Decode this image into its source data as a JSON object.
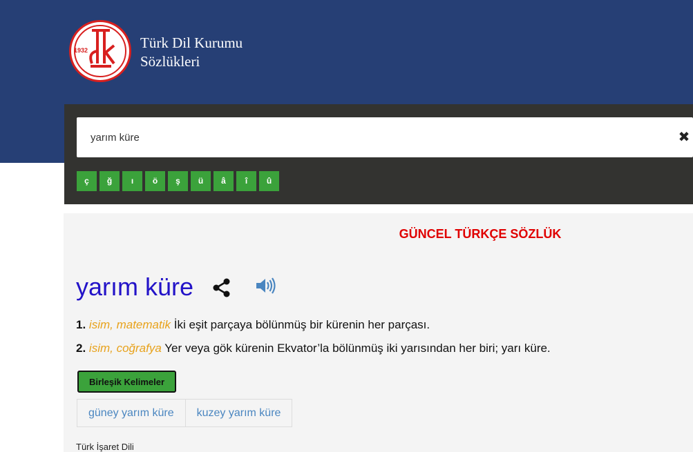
{
  "header": {
    "logo_year": "1932",
    "brand_line1": "Türk Dil Kurumu",
    "brand_line2": "Sözlükleri",
    "colors": {
      "header_bg": "#263f75",
      "logo_red": "#d8201f"
    }
  },
  "search": {
    "value": "yarım küre",
    "clear_icon": "close-icon",
    "special_chars": [
      "ç",
      "ğ",
      "ı",
      "ö",
      "ş",
      "ü",
      "â",
      "î",
      "û"
    ]
  },
  "result": {
    "dictionary_title": "GÜNCEL TÜRKÇE SÖZLÜK",
    "headword": "yarım küre",
    "meanings": [
      {
        "num": "1.",
        "tag": "isim, matematik",
        "text": "İki eşit parçaya bölünmüş bir kürenin her parçası."
      },
      {
        "num": "2.",
        "tag": "isim, coğrafya",
        "text": "Yer veya gök kürenin Ekvator’la bölünmüş iki yarısından her biri; yarı küre."
      }
    ],
    "compound_label": "Birleşik Kelimeler",
    "compounds": [
      "güney yarım küre",
      "kuzey yarım küre"
    ],
    "sign_language_label": "Türk İşaret Dili"
  }
}
